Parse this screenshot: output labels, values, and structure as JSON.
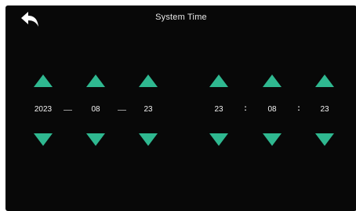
{
  "header": {
    "title": "System Time",
    "back_icon": "back-arrow-icon"
  },
  "colors": {
    "screen_background": "#080808",
    "arrow_accent": "#2fb890",
    "text": "#f2f2f2"
  },
  "date": {
    "year": "2023",
    "month": "08",
    "day": "23",
    "separator": "—"
  },
  "time": {
    "hour": "23",
    "minute": "08",
    "second": "23",
    "separator": ":"
  },
  "icons": {
    "increment": "triangle-up-icon",
    "decrement": "triangle-down-icon"
  }
}
